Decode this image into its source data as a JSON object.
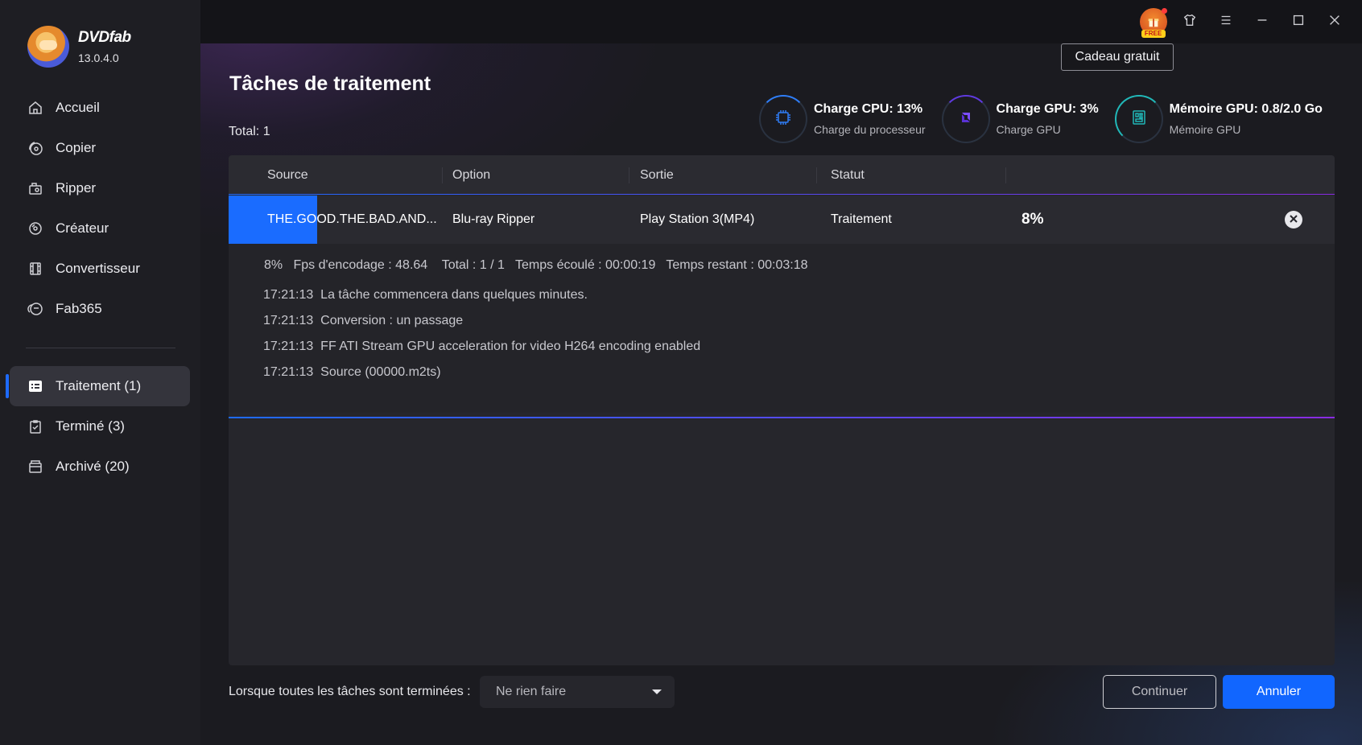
{
  "app": {
    "name": "DVDfab",
    "version": "13.0.4.0"
  },
  "sidebar": {
    "items": [
      {
        "label": "Accueil",
        "icon": "home-icon"
      },
      {
        "label": "Copier",
        "icon": "copy-disc-icon"
      },
      {
        "label": "Ripper",
        "icon": "ripper-icon"
      },
      {
        "label": "Créateur",
        "icon": "creator-disc-icon"
      },
      {
        "label": "Convertisseur",
        "icon": "film-icon"
      },
      {
        "label": "Fab365",
        "icon": "fab365-icon"
      }
    ],
    "queue": [
      {
        "label": "Traitement (1)",
        "icon": "task-list-icon",
        "active": true
      },
      {
        "label": "Terminé (3)",
        "icon": "clipboard-check-icon",
        "active": false
      },
      {
        "label": "Archivé (20)",
        "icon": "archive-box-icon",
        "active": false
      }
    ]
  },
  "topbar": {
    "gift_badge": "FREE",
    "tooltip": "Cadeau gratuit"
  },
  "page": {
    "title": "Tâches de traitement",
    "total": "Total: 1"
  },
  "stats": {
    "cpu": {
      "title": "Charge CPU: 13%",
      "sub": "Charge du processeur"
    },
    "gpu": {
      "title": "Charge GPU: 3%",
      "sub": "Charge GPU"
    },
    "mem": {
      "title": "Mémoire GPU: 0.8/2.0 Go",
      "sub": "Mémoire GPU"
    }
  },
  "table": {
    "headers": {
      "source": "Source",
      "option": "Option",
      "output": "Sortie",
      "status": "Statut"
    },
    "row": {
      "source": "THE.GOOD.THE.BAD.AND...",
      "option": "Blu-ray Ripper",
      "output": "Play Station 3(MP4)",
      "status": "Traitement",
      "progress": "8%",
      "progress_fraction": 0.08
    },
    "summary": "8%   Fps d'encodage : 48.64    Total : 1 / 1   Temps écoulé : 00:00:19   Temps restant : 00:03:18",
    "log": [
      "17:21:13  La tâche commencera dans quelques minutes.",
      "17:21:13  Conversion : un passage",
      "17:21:13  FF ATI Stream GPU acceleration for video H264 encoding enabled",
      "17:21:13  Source (00000.m2ts)"
    ]
  },
  "footer": {
    "label": "Lorsque toutes les tâches sont terminées :",
    "select_value": "Ne rien faire",
    "continue": "Continuer",
    "cancel": "Annuler"
  },
  "colors": {
    "accent": "#1166ff",
    "sidebar_bg": "#1e1e23",
    "main_bg": "#1b1b20"
  }
}
